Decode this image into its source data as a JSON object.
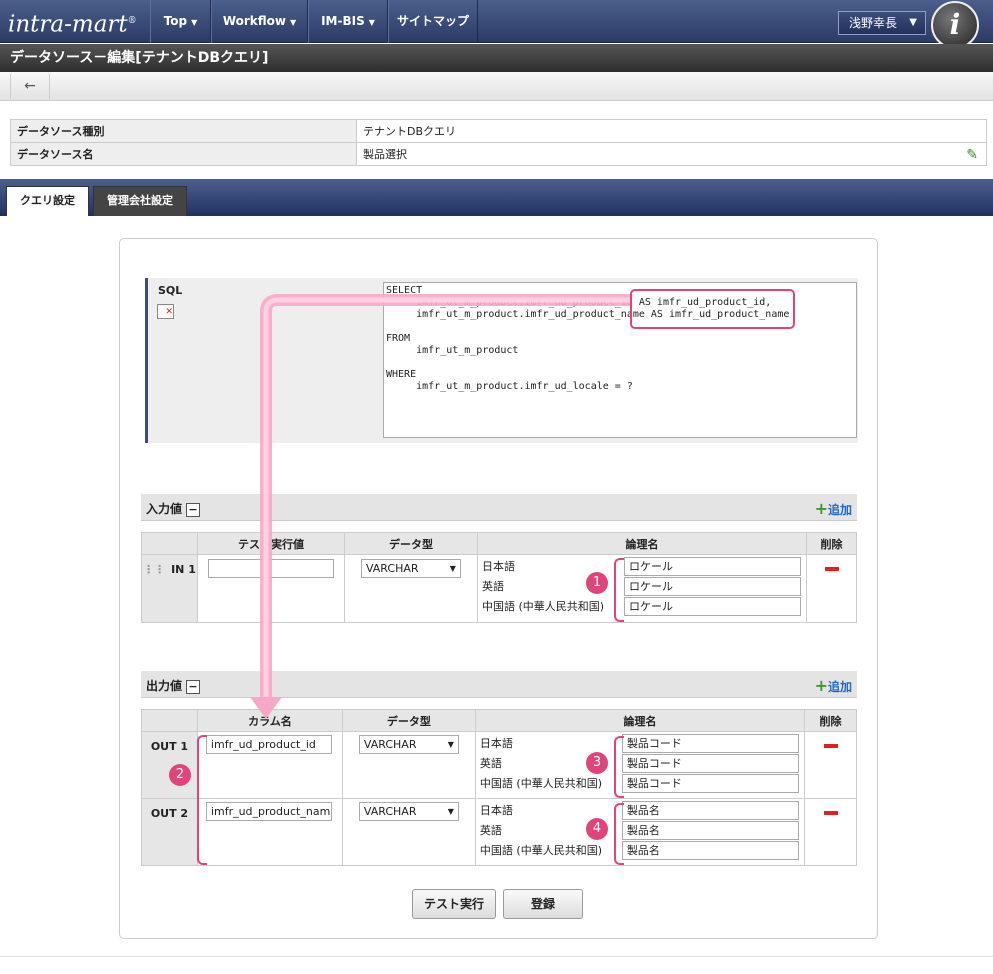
{
  "nav": {
    "logo": "intra-mart",
    "logo_mark": "®",
    "items": [
      {
        "label": "Top",
        "caret": "▼"
      },
      {
        "label": "Workflow",
        "caret": "▼"
      },
      {
        "label": "IM-BIS",
        "caret": "▼"
      },
      {
        "label": "サイトマップ",
        "caret": ""
      }
    ],
    "user": "浅野幸長",
    "avatar_letter": "i"
  },
  "page": {
    "title": "データソース－編集[テナントDBクエリ]",
    "back_icon": "←"
  },
  "info": [
    {
      "label": "データソース種別",
      "value": "テナントDBクエリ"
    },
    {
      "label": "データソース名",
      "value": "製品選択"
    }
  ],
  "tabs": [
    {
      "label": "クエリ設定",
      "active": true
    },
    {
      "label": "管理会社設定",
      "active": false
    }
  ],
  "sql": {
    "label": "SQL",
    "text": "SELECT\n     imfr_ut_m_product.imfr_ud_product_id AS imfr_ud_product_id,\n     imfr_ut_m_product.imfr_ud_product_name AS imfr_ud_product_name\n\nFROM\n     imfr_ut_m_product\n\nWHERE\n     imfr_ut_m_product.imfr_ud_locale = ?"
  },
  "input_section": {
    "title": "入力値",
    "add_label": "追加",
    "headers": [
      "",
      "テスト実行値",
      "データ型",
      "論理名",
      "削除"
    ],
    "rows": [
      {
        "key": "IN 1",
        "test_value": "",
        "type": "VARCHAR",
        "names": [
          {
            "lang": "日本語",
            "value": "ロケール"
          },
          {
            "lang": "英語",
            "value": "ロケール"
          },
          {
            "lang": "中国語 (中華人民共和国)",
            "value": "ロケール"
          }
        ]
      }
    ]
  },
  "output_section": {
    "title": "出力値",
    "add_label": "追加",
    "headers": [
      "",
      "カラム名",
      "データ型",
      "論理名",
      "削除"
    ],
    "rows": [
      {
        "key": "OUT 1",
        "column": "imfr_ud_product_id",
        "type": "VARCHAR",
        "names": [
          {
            "lang": "日本語",
            "value": "製品コード"
          },
          {
            "lang": "英語",
            "value": "製品コード"
          },
          {
            "lang": "中国語 (中華人民共和国)",
            "value": "製品コード"
          }
        ]
      },
      {
        "key": "OUT 2",
        "column": "imfr_ud_product_nam",
        "type": "VARCHAR",
        "names": [
          {
            "lang": "日本語",
            "value": "製品名"
          },
          {
            "lang": "英語",
            "value": "製品名"
          },
          {
            "lang": "中国語 (中華人民共和国)",
            "value": "製品名"
          }
        ]
      }
    ]
  },
  "buttons": {
    "test": "テスト実行",
    "save": "登録"
  },
  "callouts": [
    "1",
    "2",
    "3",
    "4"
  ],
  "accent_color": "#e0447a"
}
